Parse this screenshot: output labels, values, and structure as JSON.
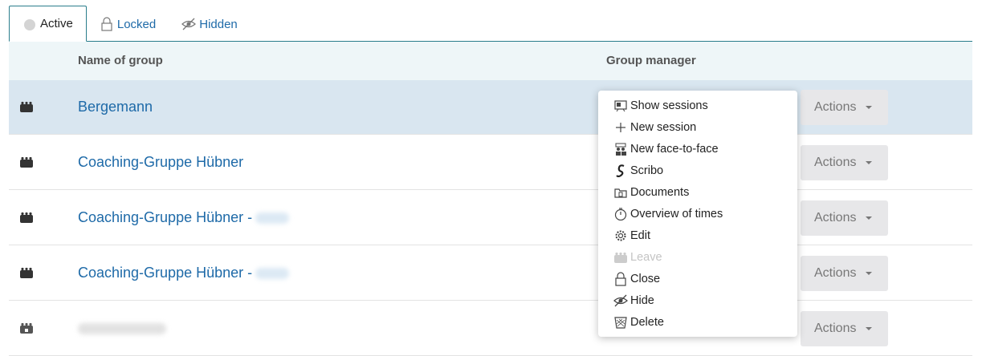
{
  "tabs": [
    {
      "label": "Active",
      "icon": "circle-icon"
    },
    {
      "label": "Locked",
      "icon": "lock-icon"
    },
    {
      "label": "Hidden",
      "icon": "eye-slash-icon"
    }
  ],
  "table": {
    "columns": {
      "name": "Name of group",
      "manager": "Group manager"
    },
    "rows": [
      {
        "name": "Bergemann"
      },
      {
        "name": "Coaching-Gruppe Hübner"
      },
      {
        "name": "Coaching-Gruppe Hübner -"
      },
      {
        "name": "Coaching-Gruppe Hübner -"
      },
      {
        "name": ""
      }
    ],
    "actions_label": "Actions"
  },
  "menu": {
    "items": [
      {
        "label": "Show sessions",
        "icon": "presentation-icon"
      },
      {
        "label": "New session",
        "icon": "plus-icon"
      },
      {
        "label": "New face-to-face",
        "icon": "people-icon"
      },
      {
        "label": "Scribo",
        "icon": "scribo-icon"
      },
      {
        "label": "Documents",
        "icon": "folder-icon"
      },
      {
        "label": "Overview of times",
        "icon": "stopwatch-icon"
      },
      {
        "label": "Edit",
        "icon": "gear-icon"
      },
      {
        "label": "Leave",
        "icon": "group-icon",
        "disabled": true
      },
      {
        "label": "Close",
        "icon": "lock-icon"
      },
      {
        "label": "Hide",
        "icon": "eye-slash-icon"
      },
      {
        "label": "Delete",
        "icon": "trash-icon"
      }
    ]
  }
}
